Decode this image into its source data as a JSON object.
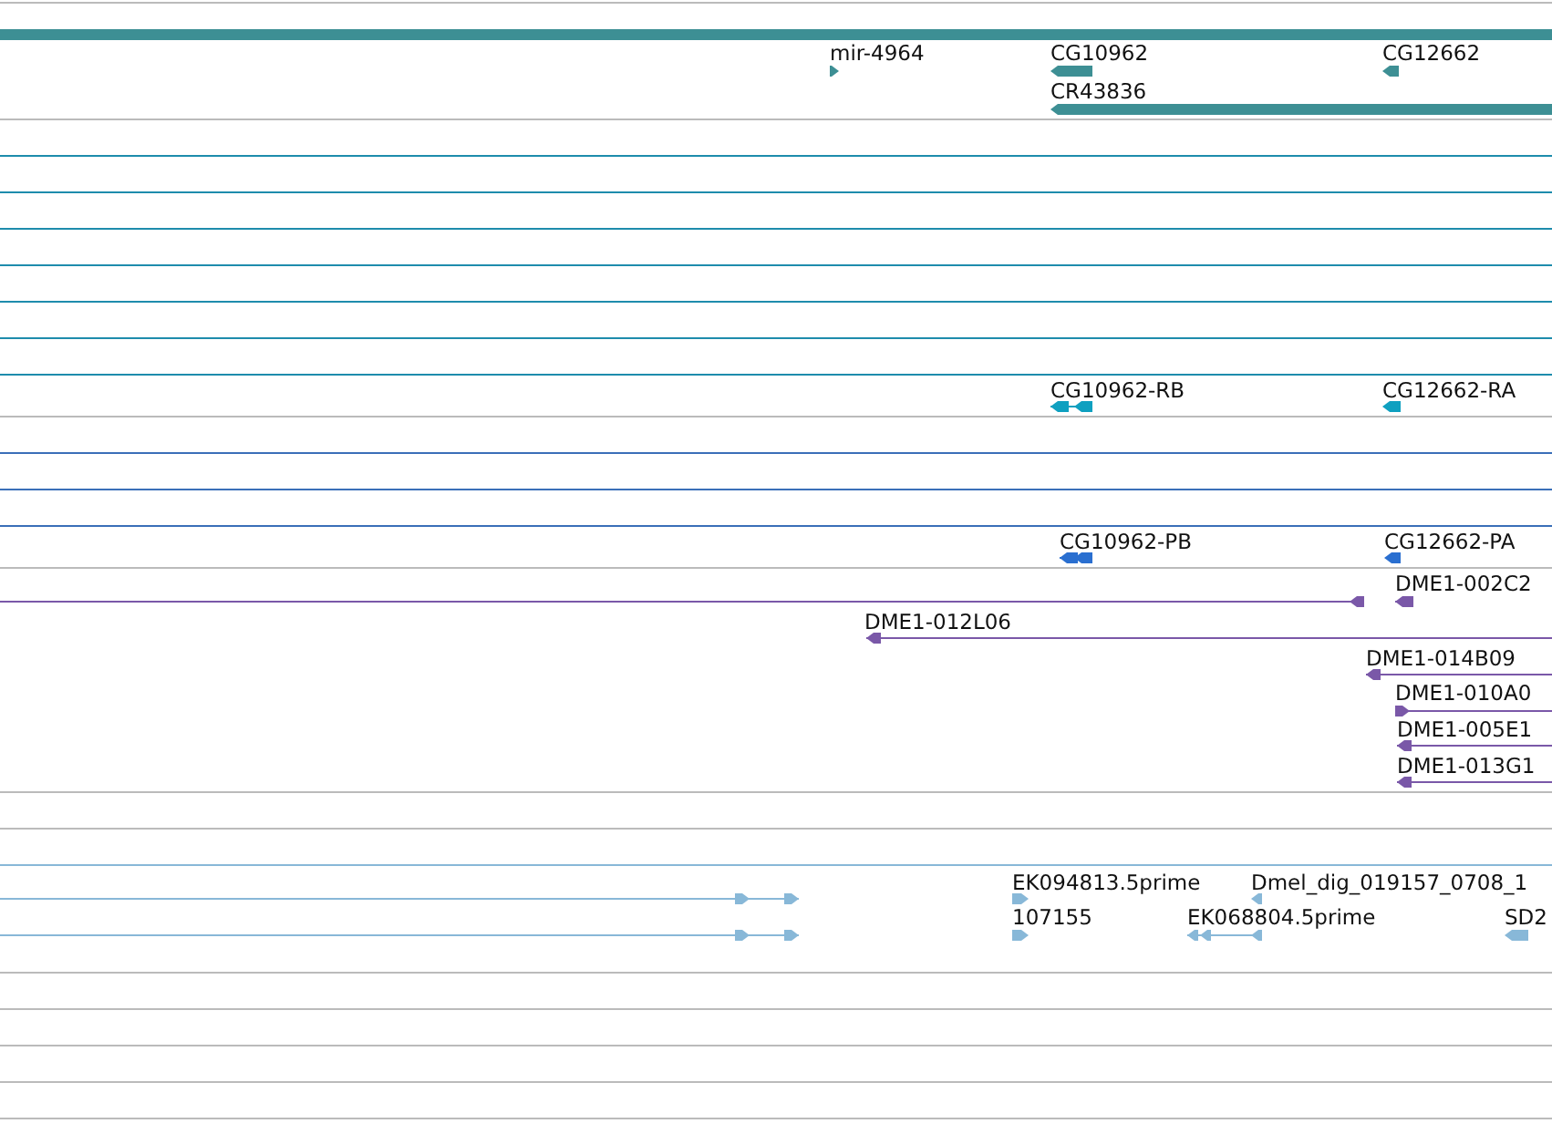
{
  "tracks": [
    {
      "color": "#3d8f94",
      "features": [
        {
          "kind": "span"
        },
        {
          "kind": "block",
          "label": "mir-4964",
          "reverse": false
        },
        {
          "kind": "block",
          "label": "CG10962",
          "reverse": true
        },
        {
          "kind": "block",
          "label": "CG12662",
          "reverse": true
        },
        {
          "kind": "block",
          "label": "CR43836",
          "reverse": true
        }
      ]
    },
    {
      "color": "#1e8cac"
    },
    {
      "color": "#1e8cac"
    },
    {
      "color": "#1e8cac"
    },
    {
      "color": "#1e8cac"
    },
    {
      "color": "#1e8cac"
    },
    {
      "color": "#1e8cac"
    },
    {
      "color": "#1e8cac"
    },
    {
      "color": "#0fa0c0",
      "features": [
        {
          "kind": "line",
          "label": "CG10962-RB",
          "reverse": true
        },
        {
          "kind": "block",
          "label": "CG12662-RA",
          "reverse": true
        }
      ]
    },
    {
      "color": "#3a6fb8"
    },
    {
      "color": "#3a6fb8"
    },
    {
      "color": "#3a6fb8"
    },
    {
      "color": "#2a6fd0",
      "features": [
        {
          "kind": "line",
          "label": "CG10962-PB",
          "reverse": true
        },
        {
          "kind": "block",
          "label": "CG12662-PA",
          "reverse": true
        }
      ]
    },
    {
      "color": "#7a58a8",
      "features": [
        {
          "kind": "line",
          "reverse": true
        },
        {
          "kind": "line",
          "label": "DME1-002C2",
          "reverse": true
        },
        {
          "kind": "line",
          "label": "DME1-012L06",
          "reverse": true
        },
        {
          "kind": "line",
          "label": "DME1-014B09",
          "reverse": true
        },
        {
          "kind": "line",
          "label": "DME1-010A0",
          "reverse": false
        },
        {
          "kind": "line",
          "label": "DME1-005E1",
          "reverse": true
        },
        {
          "kind": "line",
          "label": "DME1-013G1",
          "reverse": true
        }
      ]
    },
    {
      "color": "#bbbbbb"
    },
    {
      "color": "#88b8d8"
    },
    {
      "color": "#88b8d8",
      "features": [
        {
          "kind": "line",
          "reverse": false
        },
        {
          "kind": "line",
          "reverse": false
        },
        {
          "kind": "block",
          "label": "EK094813.5prime",
          "reverse": false
        },
        {
          "kind": "block",
          "label": "Dmel_dig_019157_0708_1",
          "reverse": true
        },
        {
          "kind": "block",
          "label": "107155",
          "reverse": false
        },
        {
          "kind": "line",
          "label": "EK068804.5prime",
          "reverse": true
        },
        {
          "kind": "block",
          "label": "SD2",
          "reverse": true
        }
      ]
    },
    {
      "color": "#bbbbbb"
    },
    {
      "color": "#bbbbbb"
    },
    {
      "color": "#bbbbbb"
    },
    {
      "color": "#bbbbbb"
    }
  ]
}
